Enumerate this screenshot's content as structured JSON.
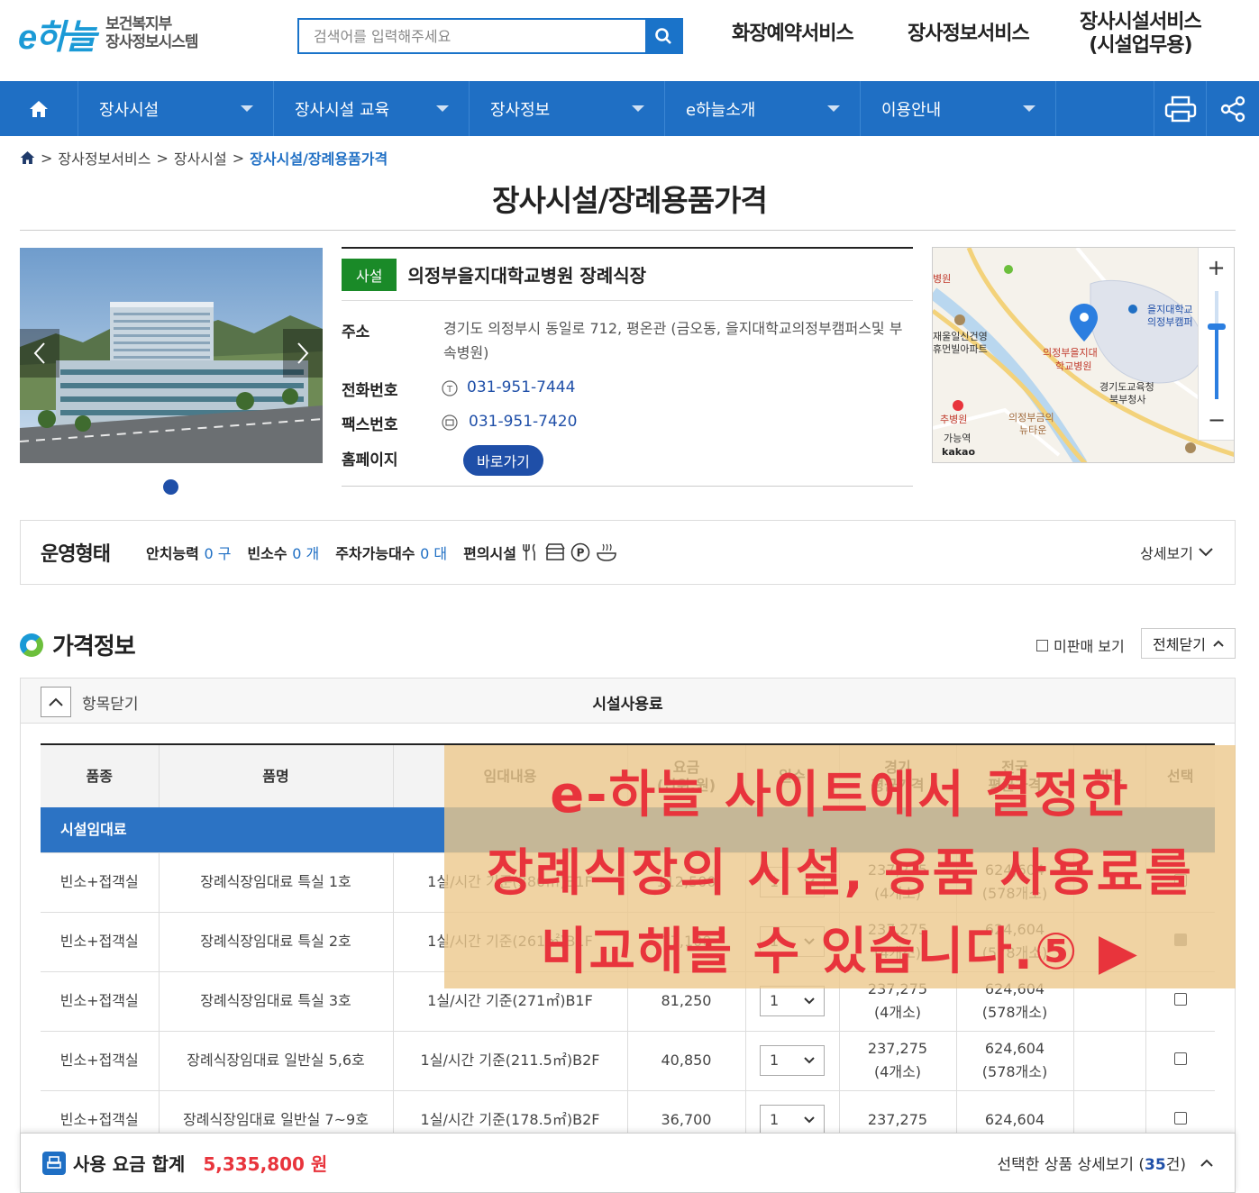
{
  "header": {
    "logo_mark": "e하늘",
    "logo_line1": "보건복지부",
    "logo_line2": "장사정보시스템",
    "search_placeholder": "검색어를 입력해주세요",
    "links": [
      "화장예약서비스",
      "장사정보서비스"
    ],
    "facility_link_line1": "장사시설서비스",
    "facility_link_line2": "(시설업무용)"
  },
  "nav": {
    "items": [
      "장사시설",
      "장사시설 교육",
      "장사정보",
      "e하늘소개",
      "이용안내"
    ]
  },
  "breadcrumb": {
    "items": [
      "장사정보서비스",
      "장사시설"
    ],
    "current": "장사시설/장례용품가격"
  },
  "page_title": "장사시설/장례용품가격",
  "facility": {
    "tag": "사설",
    "name": "의정부을지대학교병원 장례식장",
    "address_label": "주소",
    "address": "경기도 의정부시 동일로 712, 평온관 (금오동, 을지대학교의정부캠퍼스및 부속병원)",
    "phone_label": "전화번호",
    "phone": "031-951-7444",
    "fax_label": "팩스번호",
    "fax": "031-951-7420",
    "homepage_label": "홈페이지",
    "homepage_button": "바로가기"
  },
  "map": {
    "labels": {
      "hospital": "의정부을지대\n학교병원",
      "univ": "을지대학교\n의정부캠퍼",
      "office": "경기도교육청\n북부청사",
      "apt": "재울일신건영\n휴먼빌아파트",
      "newtown": "의정부금의\n뉴타운",
      "station": "가능역",
      "brand": "kakao",
      "top_left": "병원",
      "left_hosp": "추병원"
    }
  },
  "operation": {
    "title": "운영형태",
    "capacity_label": "안치능력",
    "capacity": "0 구",
    "rooms_label": "빈소수",
    "rooms": "0 개",
    "parking_label": "주차가능대수",
    "parking": "0 대",
    "amenities_label": "편의시설",
    "more": "상세보기"
  },
  "price": {
    "title": "가격정보",
    "unsold_label": "미판매 보기",
    "close_all": "전체닫기",
    "collapse_label": "항목닫기",
    "section_title": "시설사용료",
    "columns": [
      "품종",
      "품명",
      "임대내용",
      "요금\n(단위:원)",
      "일수",
      "경기\n평균가격",
      "전국\n평균가격",
      "비고",
      "선택"
    ],
    "group": "시설임대료",
    "rows": [
      {
        "kind": "빈소+접객실",
        "name": "장례식장임대료 특실 1호",
        "desc": "1실/시간 기준(380㎡)B1F",
        "fee": "112,500",
        "days": "1",
        "region_avg": "237,275",
        "region_cnt": "(4개소)",
        "nat_avg": "624,604",
        "nat_cnt": "(578개소)",
        "note": "",
        "checked": false
      },
      {
        "kind": "빈소+접객실",
        "name": "장례식장임대료 특실 2호",
        "desc": "1실/시간 기준(261㎡)B1F",
        "fee": "77,100",
        "days": "1",
        "region_avg": "237,275",
        "region_cnt": "(4개소)",
        "nat_avg": "624,604",
        "nat_cnt": "(578개소)",
        "note": "",
        "checked": true
      },
      {
        "kind": "빈소+접객실",
        "name": "장례식장임대료 특실 3호",
        "desc": "1실/시간 기준(271㎡)B1F",
        "fee": "81,250",
        "days": "1",
        "region_avg": "237,275",
        "region_cnt": "(4개소)",
        "nat_avg": "624,604",
        "nat_cnt": "(578개소)",
        "note": "",
        "checked": false
      },
      {
        "kind": "빈소+접객실",
        "name": "장례식장임대료 일반실 5,6호",
        "desc": "1실/시간 기준(211.5㎡)B2F",
        "fee": "40,850",
        "days": "1",
        "region_avg": "237,275",
        "region_cnt": "(4개소)",
        "nat_avg": "624,604",
        "nat_cnt": "(578개소)",
        "note": "",
        "checked": false
      },
      {
        "kind": "빈소+접객실",
        "name": "장례식장임대료 일반실 7~9호",
        "desc": "1실/시간 기준(178.5㎡)B2F",
        "fee": "36,700",
        "days": "1",
        "region_avg": "237,275",
        "region_cnt": "",
        "nat_avg": "624,604",
        "nat_cnt": "",
        "note": "",
        "checked": false
      }
    ]
  },
  "overlay": {
    "line1": "e-하늘 사이트에서 결정한",
    "line2": "장례식장의 시설, 용품 사용료를",
    "line3": "비교해볼 수 있습니다.⑤ ▶"
  },
  "footer": {
    "label": "사용 요금 합계",
    "total": "5,335,800 원",
    "detail_prefix": "선택한 상품 상세보기 (",
    "detail_count": "35",
    "detail_suffix": "건)"
  },
  "colors": {
    "primary": "#1f6fc4",
    "accent_red": "#e8343c",
    "tag_green": "#1a8a28"
  }
}
